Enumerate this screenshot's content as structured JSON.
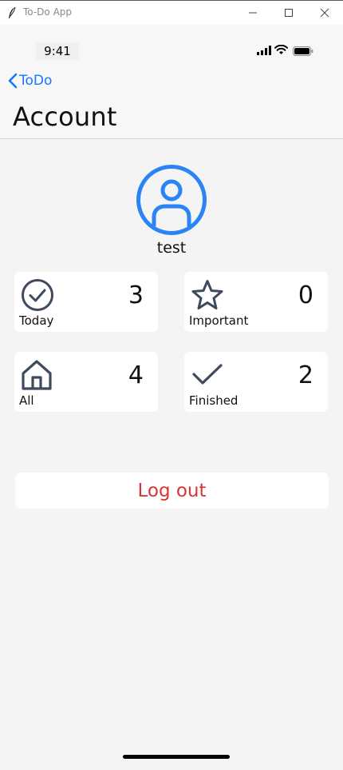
{
  "window": {
    "title": "To-Do App",
    "icons": [
      "feather-icon",
      "minimize-icon",
      "maximize-icon",
      "close-icon"
    ]
  },
  "status_bar": {
    "time": "9:41",
    "icons": [
      "cellular-signal-icon",
      "wifi-icon",
      "battery-icon"
    ]
  },
  "nav": {
    "back_label": "ToDo",
    "back_icon": "chevron-left-icon",
    "title": "Account"
  },
  "profile": {
    "avatar_icon": "user-circle-icon",
    "username": "test"
  },
  "stats": [
    {
      "label": "Today",
      "count": "3",
      "icon": "check-circle-icon"
    },
    {
      "label": "Important",
      "count": "0",
      "icon": "star-icon"
    },
    {
      "label": "All",
      "count": "4",
      "icon": "home-icon"
    },
    {
      "label": "Finished",
      "count": "2",
      "icon": "checkmark-icon"
    }
  ],
  "logout": {
    "label": "Log out"
  },
  "colors": {
    "accent": "#1478ff",
    "avatar": "#2a84f5",
    "icon": "#3f4a5e",
    "danger": "#d93434",
    "background": "#f4f4f4",
    "card": "#ffffff"
  }
}
